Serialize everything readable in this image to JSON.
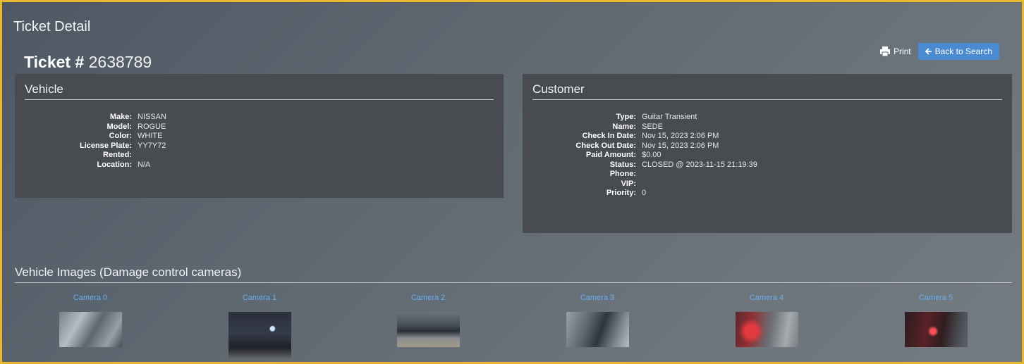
{
  "page": {
    "title": "Ticket Detail"
  },
  "ticket": {
    "label": "Ticket #",
    "number": "2638789"
  },
  "actions": {
    "print_label": "Print",
    "back_label": "Back to Search"
  },
  "vehicle": {
    "title": "Vehicle",
    "fields": [
      {
        "label": "Make:",
        "value": "NISSAN"
      },
      {
        "label": "Model:",
        "value": "ROGUE"
      },
      {
        "label": "Color:",
        "value": "WHITE"
      },
      {
        "label": "License Plate:",
        "value": "YY7Y72"
      },
      {
        "label": "Rented:",
        "value": ""
      },
      {
        "label": "Location:",
        "value": "N/A"
      }
    ]
  },
  "customer": {
    "title": "Customer",
    "fields": [
      {
        "label": "Type:",
        "value": "Guitar Transient"
      },
      {
        "label": "Name:",
        "value": "SEDE"
      },
      {
        "label": "Check In Date:",
        "value": "Nov 15, 2023 2:06 PM"
      },
      {
        "label": "Check Out Date:",
        "value": "Nov 15, 2023 2:06 PM"
      },
      {
        "label": "Paid Amount:",
        "value": "$0.00"
      },
      {
        "label": "Status:",
        "value": "CLOSED @ 2023-11-15 21:19:39"
      },
      {
        "label": "Phone:",
        "value": ""
      },
      {
        "label": "VIP:",
        "value": ""
      },
      {
        "label": "Priority:",
        "value": "0"
      }
    ]
  },
  "images": {
    "title": "Vehicle Images (Damage control cameras)",
    "cameras": [
      {
        "label": "Camera 0"
      },
      {
        "label": "Camera 1"
      },
      {
        "label": "Camera 2"
      },
      {
        "label": "Camera 3"
      },
      {
        "label": "Camera 4"
      },
      {
        "label": "Camera 5"
      }
    ]
  },
  "colors": {
    "accent": "#4a8ad1",
    "link": "#6aaef0",
    "panel": "#484c51",
    "frame": "#e8b92f"
  }
}
